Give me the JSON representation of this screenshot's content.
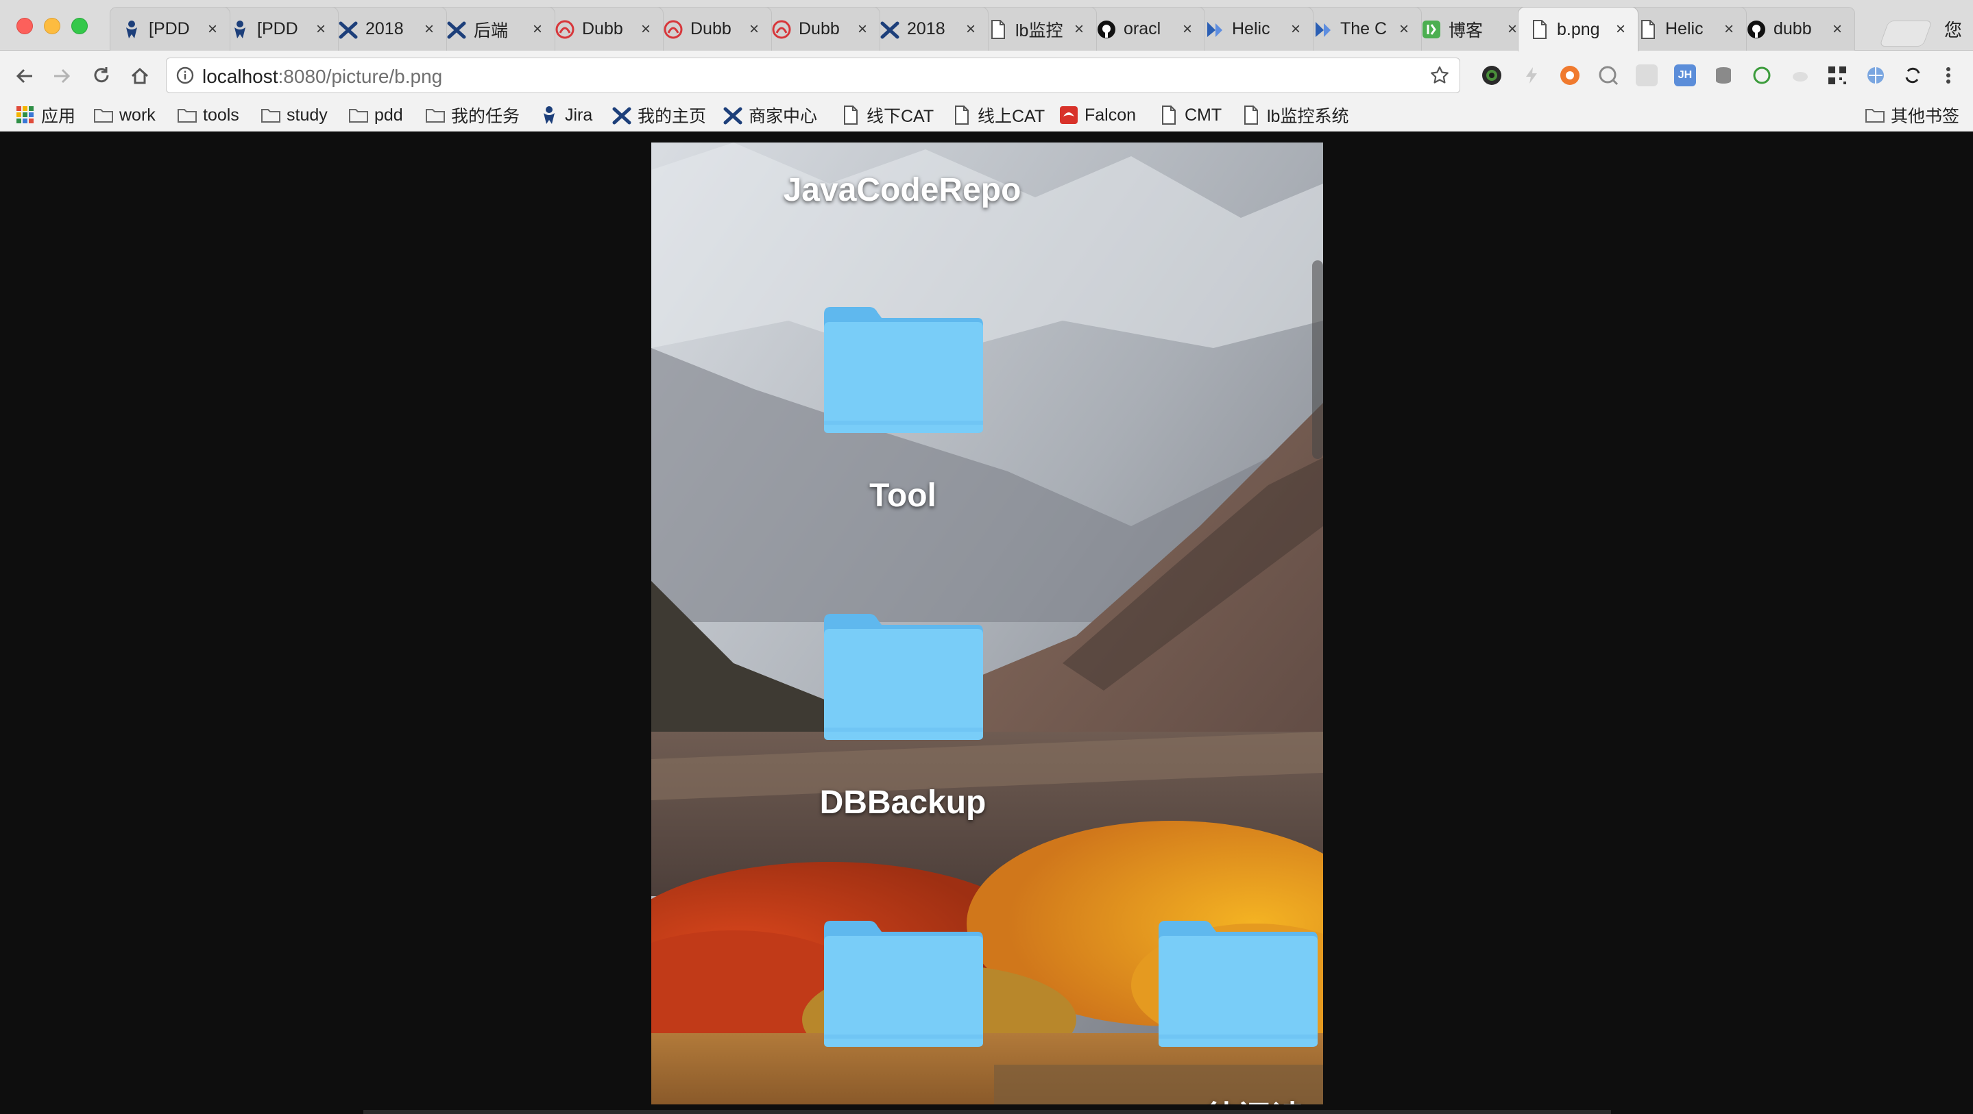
{
  "window": {
    "tabs": [
      {
        "label": "[PDD",
        "icon": "jira-icon",
        "active": false
      },
      {
        "label": "[PDD",
        "icon": "jira-icon",
        "active": false
      },
      {
        "label": "2018",
        "icon": "confluence-icon",
        "active": false
      },
      {
        "label": "后端",
        "icon": "confluence-icon",
        "active": false
      },
      {
        "label": "Dubb",
        "icon": "dubbo-icon",
        "active": false
      },
      {
        "label": "Dubb",
        "icon": "dubbo-icon",
        "active": false
      },
      {
        "label": "Dubb",
        "icon": "dubbo-icon",
        "active": false
      },
      {
        "label": "2018",
        "icon": "confluence-icon",
        "active": false
      },
      {
        "label": "lb监控",
        "icon": "page-icon",
        "active": false
      },
      {
        "label": "oracl",
        "icon": "github-icon",
        "active": false
      },
      {
        "label": "Helic",
        "icon": "helix-icon",
        "active": false
      },
      {
        "label": "The C",
        "icon": "helix-icon",
        "active": false
      },
      {
        "label": "博客",
        "icon": "blog-icon",
        "active": false
      },
      {
        "label": "b.png",
        "icon": "page-icon",
        "active": true
      },
      {
        "label": "Helic",
        "icon": "page-icon",
        "active": false
      },
      {
        "label": "dubb",
        "icon": "github-icon",
        "active": false
      }
    ],
    "profile_label": "您"
  },
  "toolbar": {
    "url_host": "localhost",
    "url_path": ":8080/picture/b.png"
  },
  "bookmarks": [
    {
      "label": "应用",
      "icon": "apps-grid-icon"
    },
    {
      "label": "work",
      "icon": "folder-icon"
    },
    {
      "label": "tools",
      "icon": "folder-icon"
    },
    {
      "label": "study",
      "icon": "folder-icon"
    },
    {
      "label": "pdd",
      "icon": "folder-icon"
    },
    {
      "label": "我的任务",
      "icon": "folder-icon"
    },
    {
      "label": "Jira",
      "icon": "jira-icon"
    },
    {
      "label": "我的主页",
      "icon": "confluence-icon"
    },
    {
      "label": "商家中心",
      "icon": "confluence-icon"
    },
    {
      "label": "线下CAT",
      "icon": "page-icon"
    },
    {
      "label": "线上CAT",
      "icon": "page-icon"
    },
    {
      "label": "Falcon",
      "icon": "falcon-icon"
    },
    {
      "label": "CMT",
      "icon": "page-icon"
    },
    {
      "label": "lb监控系统",
      "icon": "page-icon"
    }
  ],
  "bookmarks_other": "其他书签",
  "viewer": {
    "desktop_labels": {
      "javacoderepo": "JavaCodeRepo",
      "tool": "Tool",
      "dbbackup": "DBBackup",
      "partial_bottom": "待阅读"
    },
    "folder_color": "#6ccdf7"
  }
}
